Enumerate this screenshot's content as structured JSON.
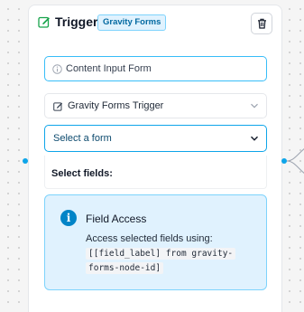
{
  "node": {
    "title": "Trigger",
    "badge": "Gravity Forms",
    "icons": {
      "title": "edit-square-icon",
      "delete": "trash-icon"
    }
  },
  "fields": {
    "label_input": {
      "value": "Content Input Form",
      "icon": "info-circle-icon"
    },
    "trigger_select": {
      "value": "Gravity Forms Trigger",
      "icon": "edit-square-icon"
    },
    "form_select": {
      "placeholder": "Select a form"
    }
  },
  "select_fields": {
    "label": "Select fields:"
  },
  "field_access": {
    "title": "Field Access",
    "description": "Access selected fields using:",
    "code": "[[field_label] from gravity-forms-node-id]"
  },
  "colors": {
    "accent": "#0ea5e9",
    "badge_bg": "#e0f2fe",
    "badge_text": "#0369a1",
    "title_icon": "#16a34a",
    "info_icon": "#0284c7"
  }
}
